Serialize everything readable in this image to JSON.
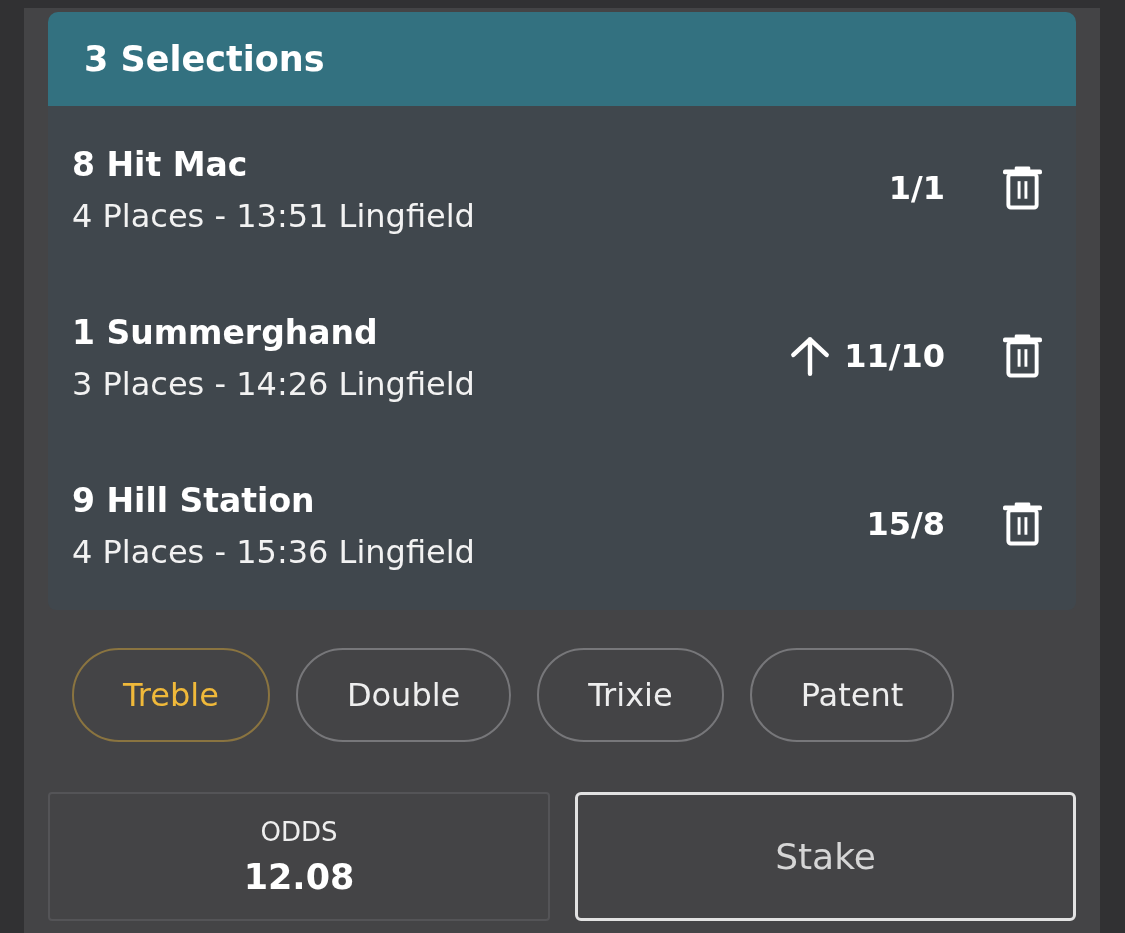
{
  "header": {
    "title": "3 Selections"
  },
  "selections": [
    {
      "name": "8 Hit Mac",
      "market": "4 Places - 13:51 Lingfield",
      "price": "1/1",
      "price_rising": false
    },
    {
      "name": "1 Summerghand",
      "market": "3 Places - 14:26 Lingfield",
      "price": "11/10",
      "price_rising": true
    },
    {
      "name": "9 Hill Station",
      "market": "4 Places - 15:36 Lingfield",
      "price": "15/8",
      "price_rising": false
    }
  ],
  "bet_types": [
    {
      "label": "Treble",
      "selected": true
    },
    {
      "label": "Double",
      "selected": false
    },
    {
      "label": "Trixie",
      "selected": false
    },
    {
      "label": "Patent",
      "selected": false
    }
  ],
  "summary": {
    "odds_label": "ODDS",
    "odds_value": "12.08"
  },
  "stake": {
    "placeholder": "Stake"
  }
}
